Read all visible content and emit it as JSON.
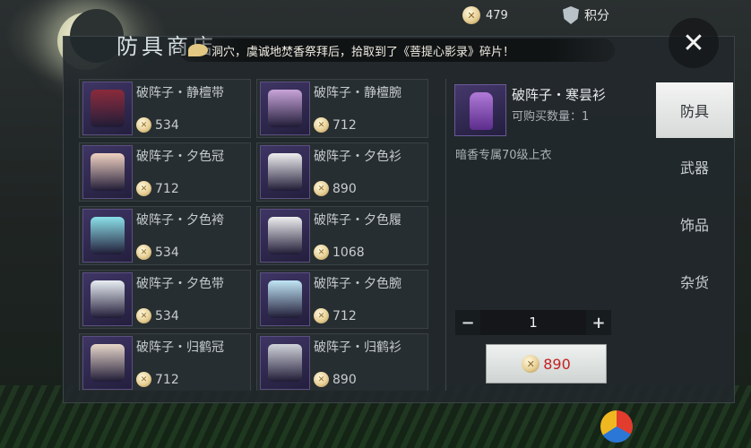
{
  "topbar": {
    "currency_value": "479",
    "points_label": "积分"
  },
  "shop": {
    "title": "防具商店",
    "close_label": "✕"
  },
  "ticker": {
    "message": "洞穴，虞诚地焚香祭拜后，拾取到了《菩提心影录》碎片！"
  },
  "items": [
    {
      "name": "破阵子・静檀带",
      "price": "534",
      "icon": "belt-icon",
      "color": "#8a2a3a"
    },
    {
      "name": "破阵子・静檀腕",
      "price": "712",
      "icon": "bracer-icon",
      "color": "#c8a4d8"
    },
    {
      "name": "破阵子・夕色冠",
      "price": "712",
      "icon": "crown-icon",
      "color": "#f0d2c0"
    },
    {
      "name": "破阵子・夕色衫",
      "price": "890",
      "icon": "robe-icon",
      "color": "#eeeeee"
    },
    {
      "name": "破阵子・夕色袴",
      "price": "534",
      "icon": "trousers-icon",
      "color": "#8ae0e8"
    },
    {
      "name": "破阵子・夕色履",
      "price": "1068",
      "icon": "boots-icon",
      "color": "#eeeeee"
    },
    {
      "name": "破阵子・夕色带",
      "price": "534",
      "icon": "belt-icon",
      "color": "#e8eef2"
    },
    {
      "name": "破阵子・夕色腕",
      "price": "712",
      "icon": "bracer-icon",
      "color": "#bfe6f4"
    },
    {
      "name": "破阵子・归鹤冠",
      "price": "712",
      "icon": "crown-icon",
      "color": "#e6d6c8"
    },
    {
      "name": "破阵子・归鹤衫",
      "price": "890",
      "icon": "robe-icon",
      "color": "#cfd2d8"
    }
  ],
  "detail": {
    "name": "破阵子・寒昙衫",
    "qty_label": "可购买数量：1",
    "description": "暗香专属70级上衣",
    "quantity": "1",
    "price": "890",
    "minus": "−",
    "plus": "+"
  },
  "tabs": [
    {
      "label": "防具",
      "active": true
    },
    {
      "label": "武器",
      "active": false
    },
    {
      "label": "饰品",
      "active": false
    },
    {
      "label": "杂货",
      "active": false
    }
  ],
  "colors": {
    "price_red": "#c22222",
    "panel_bg": "#22282b",
    "accent_gold": "#e7cf95"
  }
}
